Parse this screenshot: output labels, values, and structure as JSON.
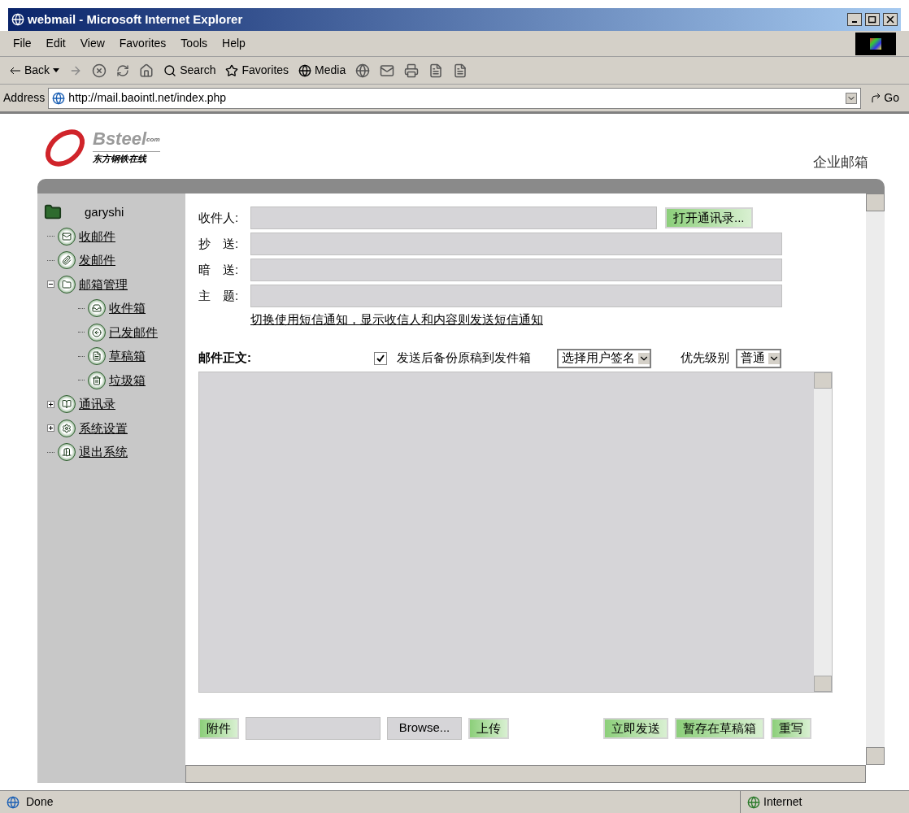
{
  "window": {
    "title": "webmail - Microsoft Internet Explorer"
  },
  "menu": [
    "File",
    "Edit",
    "View",
    "Favorites",
    "Tools",
    "Help"
  ],
  "toolbar": {
    "back": "Back",
    "search": "Search",
    "favorites": "Favorites",
    "media": "Media"
  },
  "address": {
    "label": "Address",
    "url": "http://mail.baointl.net/index.php",
    "go": "Go"
  },
  "logo": {
    "name": "Bsteel",
    "suffix": "com",
    "tagline": "东方钢铁在线"
  },
  "header": {
    "title": "企业邮箱"
  },
  "tree": {
    "user": "garyshi",
    "items": [
      {
        "label": "收邮件"
      },
      {
        "label": "发邮件"
      },
      {
        "label": "邮箱管理",
        "expanded": true,
        "children": [
          {
            "label": "收件箱"
          },
          {
            "label": "已发邮件"
          },
          {
            "label": "草稿箱"
          },
          {
            "label": "垃圾箱"
          }
        ]
      },
      {
        "label": "通讯录",
        "expanded": false
      },
      {
        "label": "系统设置",
        "expanded": false
      },
      {
        "label": "退出系统"
      }
    ]
  },
  "form": {
    "fields": [
      {
        "label": "收件人:"
      },
      {
        "label": "抄　送:"
      },
      {
        "label": "暗　送:"
      },
      {
        "label": "主　题:"
      }
    ],
    "address_book_button": "打开通讯录...",
    "sms_link": "切换使用短信通知，显示收信人和内容则发送短信通知",
    "body_label": "邮件正文:",
    "backup": {
      "label": "发送后备份原稿到发件箱",
      "checked": true
    },
    "signature": "选择用户签名",
    "priority_label": "优先级别",
    "priority": "普通",
    "attach_label": "附件",
    "browse": "Browse...",
    "upload": "上传",
    "actions": [
      "立即发送",
      "暂存在草稿箱",
      "重写"
    ]
  },
  "status_bar": {
    "text": "Done",
    "zone": "Internet"
  }
}
